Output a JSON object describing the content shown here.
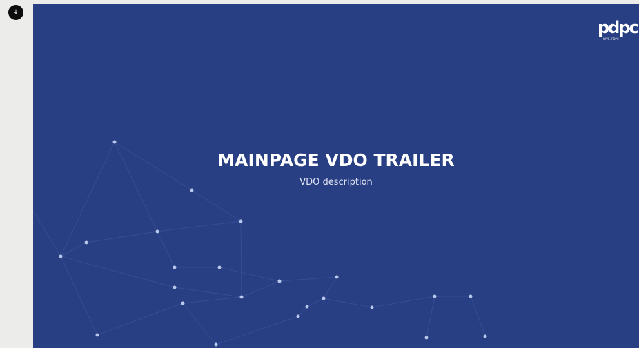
{
  "scroll_badge": {
    "label": "↓"
  },
  "brand": {
    "logo_text": "pdpc",
    "logo_subtext": "DIVE. PDPC"
  },
  "hero": {
    "title": "MAINPAGE VDO TRAILER",
    "description": "VDO description"
  },
  "colors": {
    "hero_background": "#293f83",
    "page_background": "#ececea",
    "node_color": "#b9c9ee",
    "text": "#ffffff"
  }
}
